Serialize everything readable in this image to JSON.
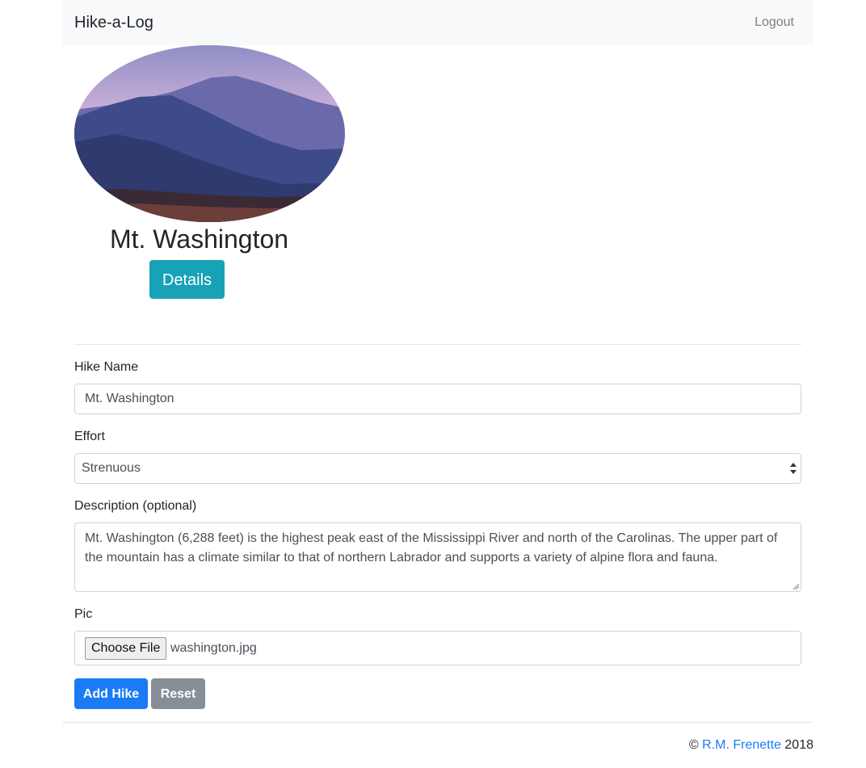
{
  "navbar": {
    "brand": "Hike-a-Log",
    "logout": "Logout"
  },
  "hike_card": {
    "title": "Mt. Washington",
    "details_button": "Details",
    "image_icon": "mountain-photo"
  },
  "form": {
    "name_label": "Hike Name",
    "name_value": "Mt. Washington",
    "effort_label": "Effort",
    "effort_value": "Strenuous",
    "description_label": "Description (optional)",
    "description_value": "Mt. Washington (6,288 feet) is the highest peak east of the Mississippi River and north of the Carolinas. The upper part of the mountain has a climate similar to that of northern Labrador and supports a variety of alpine flora and fauna.",
    "pic_label": "Pic",
    "choose_file": "Choose File",
    "file_name": "washington.jpg",
    "add_button": "Add Hike",
    "reset_button": "Reset"
  },
  "footer": {
    "copyright": "©",
    "author": "R.M. Frenette",
    "year": "2018"
  },
  "colors": {
    "info": "#17a2b8",
    "primary": "#1a7bf5",
    "secondary": "#868e96",
    "navbar_bg": "#f8f9fa"
  }
}
